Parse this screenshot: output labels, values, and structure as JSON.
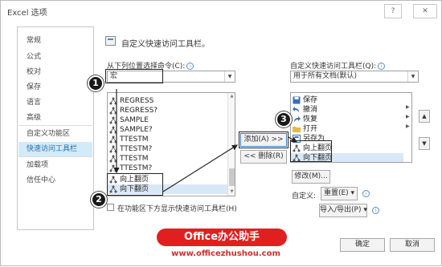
{
  "window": {
    "title": "Excel 选项",
    "help_label": "?",
    "close_label": "✕"
  },
  "sidebar": {
    "items": [
      {
        "label": "常规"
      },
      {
        "label": "公式"
      },
      {
        "label": "校对"
      },
      {
        "label": "保存"
      },
      {
        "label": "语言"
      },
      {
        "label": "高级"
      },
      {
        "label": "自定义功能区"
      },
      {
        "label": "快速访问工具栏",
        "active": true
      },
      {
        "label": "加载项"
      },
      {
        "label": "信任中心"
      }
    ]
  },
  "header": {
    "title": "自定义快速访问工具栏。"
  },
  "left_panel": {
    "choose_label": "从下列位置选择命令(C):",
    "choose_value": "宏",
    "commands": [
      "REGRESS",
      "REGRESS?",
      "SAMPLE",
      "SAMPLE?",
      "TTESTM",
      "TTESTM?",
      "TTESTM",
      "TTESTM?",
      "向上翻页",
      "向下翻页"
    ],
    "show_below_label": "在功能区下方显示快速访问工具栏(H)"
  },
  "middle": {
    "add_label": "添加(A) >>",
    "remove_label": "<< 删除(R)"
  },
  "right_panel": {
    "customize_label": "自定义快速访问工具栏(Q):",
    "customize_value": "用于所有文档(默认)",
    "items": [
      {
        "label": "保存",
        "icon": "save-icon"
      },
      {
        "label": "撤消",
        "icon": "undo-icon"
      },
      {
        "label": "恢复",
        "icon": "redo-icon"
      },
      {
        "label": "打开",
        "icon": "open-folder-icon"
      },
      {
        "label": "另存为",
        "icon": "save-as-icon"
      },
      {
        "label": "向上翻页",
        "icon": "macro-icon"
      },
      {
        "label": "向下翻页",
        "icon": "macro-icon"
      }
    ],
    "modify_label": "修改(M)...",
    "customizations_label": "自定义:",
    "reset_label": "重置(E) ▾",
    "import_export_label": "导入/导出(P) ▾"
  },
  "markers": {
    "one": "1",
    "two": "2",
    "three": "3"
  },
  "footer": {
    "ok_label": "确定",
    "cancel_label": "取消"
  },
  "watermark": {
    "banner": "Office办公助手",
    "url": "www.officezhushou.com"
  },
  "colors": {
    "accent": "#1e6db3",
    "active_bg": "#d3ebf8",
    "banner": "#e02020"
  }
}
